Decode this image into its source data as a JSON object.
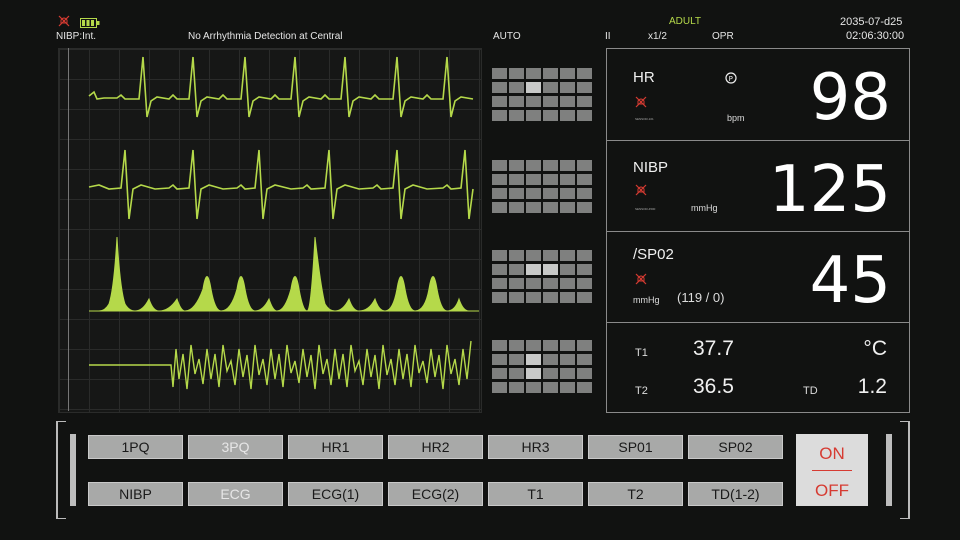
{
  "header": {
    "nibp_mode": "NIBP:Int.",
    "arrhythmia": "No Arrhythmia Detection at Central",
    "auto": "AUTO",
    "lead": "II",
    "scale": "x1/2",
    "opr": "OPR",
    "patient": "ADULT",
    "date": "2035-07-d25",
    "time": "02:06:30:00"
  },
  "vitals": {
    "hr": {
      "label": "HR",
      "unit": "bpm",
      "value": "98",
      "small": "SENSOR-101"
    },
    "nibp": {
      "label": "NIBP",
      "unit": "mmHg",
      "value": "125",
      "small": "SENSOR-4500"
    },
    "spo2": {
      "label": "/SP02",
      "unit": "mmHg",
      "value": "45",
      "sub": "(119 / 0)"
    },
    "temp": {
      "t1_label": "T1",
      "t1_value": "37.7",
      "t2_label": "T2",
      "t2_value": "36.5",
      "unit": "°C",
      "td_label": "TD",
      "td_value": "1.2"
    }
  },
  "buttons": {
    "row1": [
      "1PQ",
      "3PQ",
      "HR1",
      "HR2",
      "HR3",
      "SP01",
      "SP02"
    ],
    "row2": [
      "NIBP",
      "ECG",
      "ECG(1)",
      "ECG(2)",
      "T1",
      "T2",
      "TD(1-2)"
    ],
    "on": "ON",
    "off": "OFF"
  },
  "colors": {
    "wave": "#b5d94a",
    "accent_red": "#d63b32",
    "panel_border": "#8a8a8a"
  },
  "icons": [
    "bell-muted-icon",
    "battery-icon",
    "pacer-icon"
  ]
}
